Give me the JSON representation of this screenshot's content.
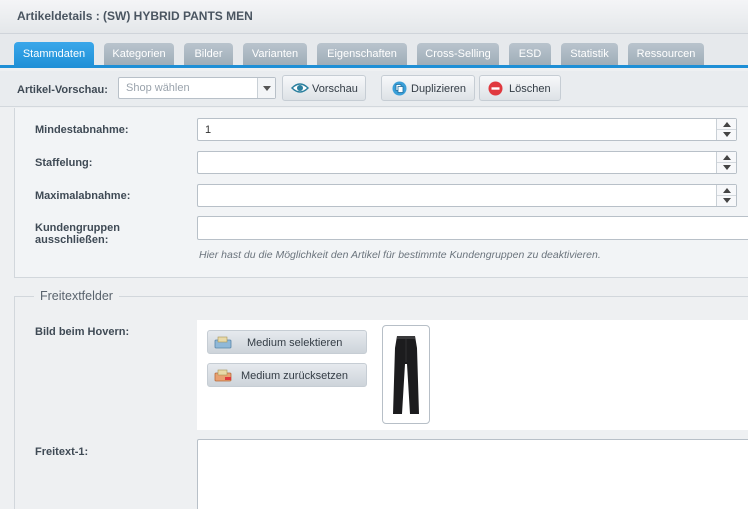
{
  "window": {
    "title": "Artikeldetails : (SW) HYBRID PANTS MEN"
  },
  "tabs": [
    {
      "label": "Stammdaten",
      "active": true
    },
    {
      "label": "Kategorien",
      "active": false
    },
    {
      "label": "Bilder",
      "active": false
    },
    {
      "label": "Varianten",
      "active": false
    },
    {
      "label": "Eigenschaften",
      "active": false
    },
    {
      "label": "Cross-Selling",
      "active": false
    },
    {
      "label": "ESD",
      "active": false
    },
    {
      "label": "Statistik",
      "active": false
    },
    {
      "label": "Ressourcen",
      "active": false
    }
  ],
  "toolbar": {
    "preview_label": "Artikel-Vorschau:",
    "shop_select": {
      "placeholder": "Shop wählen"
    },
    "preview_button": "Vorschau",
    "duplicate_button": "Duplizieren",
    "delete_button": "Löschen"
  },
  "form": {
    "min_order": {
      "label": "Mindestabnahme:",
      "value": "1"
    },
    "graduation": {
      "label": "Staffelung:",
      "value": ""
    },
    "max_order": {
      "label": "Maximalabnahme:",
      "value": ""
    },
    "exclude_groups": {
      "label_line1": "Kundengruppen",
      "label_line2": "ausschließen:",
      "value": "",
      "hint": "Hier hast du die Möglichkeit den Artikel für bestimmte Kundengruppen zu deaktivieren."
    }
  },
  "freetext": {
    "legend": "Freitextfelder",
    "hover_image": {
      "label": "Bild beim Hovern:",
      "select_button": "Medium selektieren",
      "reset_button": "Medium zurücksetzen"
    },
    "freetext1": {
      "label": "Freitext-1:",
      "value": ""
    }
  },
  "colors": {
    "accent": "#1e8fd6",
    "tab_inactive": "#a9b6c0",
    "delete_red": "#e0383e",
    "preview_teal": "#2a7f9e"
  },
  "icons": {
    "preview": "eye-icon",
    "duplicate": "duplicate-icon",
    "delete": "delete-icon",
    "media_select": "media-select-icon",
    "media_reset": "media-reset-icon"
  }
}
